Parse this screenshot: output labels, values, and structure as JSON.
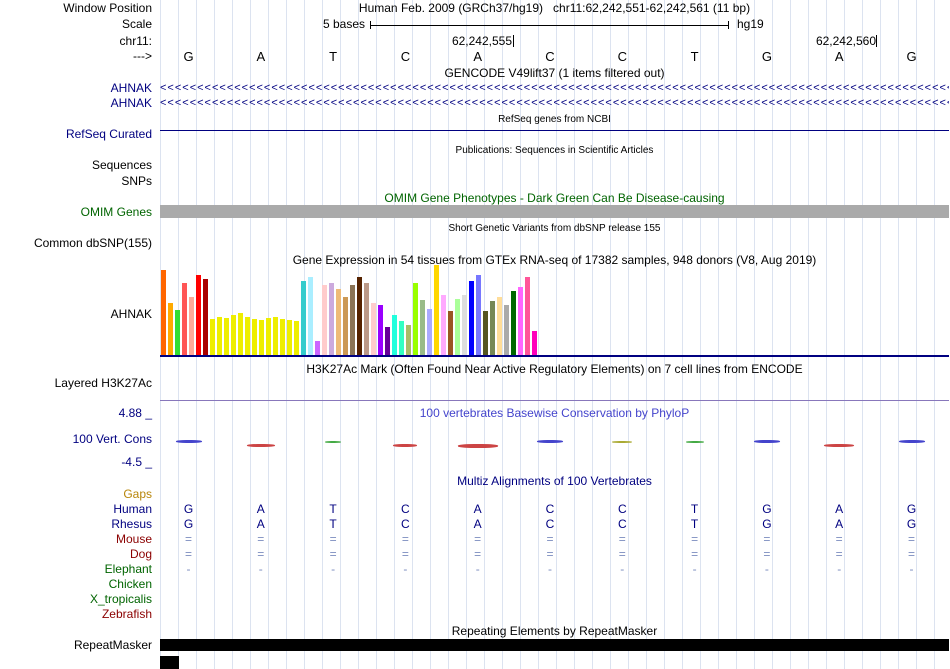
{
  "header": {
    "window_position_label": "Window Position",
    "position_title": "Human Feb. 2009 (GRCh37/hg19)   chr11:62,242,551-62,242,561 (11 bp)",
    "scale_label": "Scale",
    "scale_text": "5 bases",
    "assembly": "hg19",
    "chrom_label": "chr11:",
    "strand_label": "--->",
    "ruler_labels": [
      "62,242,555",
      "62,242,560"
    ],
    "bases": [
      "G",
      "A",
      "T",
      "C",
      "A",
      "C",
      "C",
      "T",
      "G",
      "A",
      "G"
    ]
  },
  "gencode": {
    "title": "GENCODE V49lift37 (1 items filtered out)",
    "genes": [
      "AHNAK",
      "AHNAK"
    ],
    "strand_arrow": "<"
  },
  "refseq": {
    "label": "RefSeq Curated",
    "caption": "RefSeq genes from NCBI"
  },
  "publications": {
    "caption": "Publications: Sequences in Scientific Articles",
    "label": "Sequences"
  },
  "snps": {
    "label": "SNPs"
  },
  "omim": {
    "caption": "OMIM Gene Phenotypes - Dark Green Can Be Disease-causing",
    "label": "OMIM Genes",
    "bar_color": "#aaaaaa"
  },
  "dbsnp": {
    "caption": "Short Genetic Variants from dbSNP release 155",
    "label": "Common dbSNP(155)"
  },
  "gtex": {
    "caption": "Gene Expression in 54 tissues from GTEx RNA-seq of 17382 samples, 948 donors (V8, Aug 2019)",
    "label": "AHNAK",
    "bars": [
      {
        "c": "#ff6600",
        "h": 85
      },
      {
        "c": "#ffaa00",
        "h": 52
      },
      {
        "c": "#33dd33",
        "h": 45
      },
      {
        "c": "#ff5555",
        "h": 72
      },
      {
        "c": "#ffaa99",
        "h": 58
      },
      {
        "c": "#ff0000",
        "h": 80
      },
      {
        "c": "#aa0000",
        "h": 76
      },
      {
        "c": "#eeee00",
        "h": 36
      },
      {
        "c": "#eeee00",
        "h": 38
      },
      {
        "c": "#eeee00",
        "h": 37
      },
      {
        "c": "#eeee00",
        "h": 40
      },
      {
        "c": "#eeee00",
        "h": 42
      },
      {
        "c": "#eeee00",
        "h": 38
      },
      {
        "c": "#eeee00",
        "h": 36
      },
      {
        "c": "#eeee00",
        "h": 35
      },
      {
        "c": "#eeee00",
        "h": 37
      },
      {
        "c": "#eeee00",
        "h": 38
      },
      {
        "c": "#eeee00",
        "h": 36
      },
      {
        "c": "#eeee00",
        "h": 35
      },
      {
        "c": "#eeee00",
        "h": 34
      },
      {
        "c": "#33cccc",
        "h": 74
      },
      {
        "c": "#aaeeff",
        "h": 78
      },
      {
        "c": "#cc66ff",
        "h": 14
      },
      {
        "c": "#ffcccc",
        "h": 70
      },
      {
        "c": "#ccaadd",
        "h": 72
      },
      {
        "c": "#eebb77",
        "h": 66
      },
      {
        "c": "#cc9955",
        "h": 58
      },
      {
        "c": "#8b7355",
        "h": 70
      },
      {
        "c": "#552200",
        "h": 78
      },
      {
        "c": "#bb9988",
        "h": 72
      },
      {
        "c": "#ffcccc",
        "h": 52
      },
      {
        "c": "#9900ff",
        "h": 50
      },
      {
        "c": "#660099",
        "h": 28
      },
      {
        "c": "#22ffdd",
        "h": 40
      },
      {
        "c": "#33ffc2",
        "h": 34
      },
      {
        "c": "#aabb66",
        "h": 30
      },
      {
        "c": "#99ff00",
        "h": 72
      },
      {
        "c": "#99bb88",
        "h": 55
      },
      {
        "c": "#aaaaff",
        "h": 46
      },
      {
        "c": "#ffd700",
        "h": 90
      },
      {
        "c": "#ffaaff",
        "h": 60
      },
      {
        "c": "#995522",
        "h": 44
      },
      {
        "c": "#aaff99",
        "h": 56
      },
      {
        "c": "#dddddd",
        "h": 60
      },
      {
        "c": "#0000ff",
        "h": 74
      },
      {
        "c": "#7777ff",
        "h": 80
      },
      {
        "c": "#555522",
        "h": 44
      },
      {
        "c": "#778855",
        "h": 54
      },
      {
        "c": "#ffdd99",
        "h": 58
      },
      {
        "c": "#aaaaaa",
        "h": 50
      },
      {
        "c": "#006600",
        "h": 64
      },
      {
        "c": "#ff66ff",
        "h": 68
      },
      {
        "c": "#ff5599",
        "h": 78
      },
      {
        "c": "#ff00bb",
        "h": 24
      }
    ]
  },
  "h3k27ac": {
    "caption": "H3K27Ac Mark (Often Found Near Active Regulatory Elements) on 7 cell lines from ENCODE",
    "label": "Layered H3K27Ac"
  },
  "conservation": {
    "caption": "100 vertebrates Basewise Conservation by PhyloP",
    "label": "100 Vert. Cons",
    "max_label": "4.88 _",
    "min_label": "-4.5 _",
    "marks": [
      {
        "col": 0,
        "color": "#4444cc",
        "dir": "up",
        "w": 26,
        "h": 3
      },
      {
        "col": 1,
        "color": "#cc4444",
        "dir": "down",
        "w": 28,
        "h": 3
      },
      {
        "col": 2,
        "color": "#44aa44",
        "dir": "up",
        "w": 16,
        "h": 2
      },
      {
        "col": 3,
        "color": "#cc4444",
        "dir": "down",
        "w": 24,
        "h": 3
      },
      {
        "col": 4,
        "color": "#cc4444",
        "dir": "down",
        "w": 40,
        "h": 4
      },
      {
        "col": 5,
        "color": "#4444cc",
        "dir": "up",
        "w": 26,
        "h": 3
      },
      {
        "col": 6,
        "color": "#aaaa33",
        "dir": "up",
        "w": 20,
        "h": 2
      },
      {
        "col": 7,
        "color": "#44aa44",
        "dir": "up",
        "w": 18,
        "h": 2
      },
      {
        "col": 8,
        "color": "#4444cc",
        "dir": "up",
        "w": 26,
        "h": 3
      },
      {
        "col": 9,
        "color": "#cc4444",
        "dir": "down",
        "w": 30,
        "h": 3
      },
      {
        "col": 10,
        "color": "#4444cc",
        "dir": "up",
        "w": 26,
        "h": 3
      }
    ]
  },
  "multiz": {
    "caption": "Multiz Alignments of 100 Vertebrates",
    "species": [
      {
        "name": "Gaps",
        "color": "#b8860b",
        "cell_color": "#7b8cbf",
        "cells": []
      },
      {
        "name": "Human",
        "color": "#000080",
        "cell_color": "#000080",
        "cells": [
          "G",
          "A",
          "T",
          "C",
          "A",
          "C",
          "C",
          "T",
          "G",
          "A",
          "G"
        ]
      },
      {
        "name": "Rhesus",
        "color": "#000080",
        "cell_color": "#000080",
        "cells": [
          "G",
          "A",
          "T",
          "C",
          "A",
          "C",
          "C",
          "T",
          "G",
          "A",
          "G"
        ]
      },
      {
        "name": "Mouse",
        "color": "#8b0000",
        "cell_color": "#7b8cbf",
        "cells": [
          "=",
          "=",
          "=",
          "=",
          "=",
          "=",
          "=",
          "=",
          "=",
          "=",
          "="
        ]
      },
      {
        "name": "Dog",
        "color": "#8b0000",
        "cell_color": "#7b8cbf",
        "cells": [
          "=",
          "=",
          "=",
          "=",
          "=",
          "=",
          "=",
          "=",
          "=",
          "=",
          "="
        ]
      },
      {
        "name": "Elephant",
        "color": "#006400",
        "cell_color": "#7b8cbf",
        "cells": [
          "-",
          "-",
          "-",
          "-",
          "-",
          "-",
          "-",
          "-",
          "-",
          "-",
          "-"
        ]
      },
      {
        "name": "Chicken",
        "color": "#006400",
        "cell_color": "#7b8cbf",
        "cells": []
      },
      {
        "name": "X_tropicalis",
        "color": "#006400",
        "cell_color": "#7b8cbf",
        "cells": []
      },
      {
        "name": "Zebrafish",
        "color": "#8b0000",
        "cell_color": "#7b8cbf",
        "cells": []
      }
    ]
  },
  "repeatmasker": {
    "caption": "Repeating Elements by RepeatMasker",
    "label": "RepeatMasker"
  }
}
